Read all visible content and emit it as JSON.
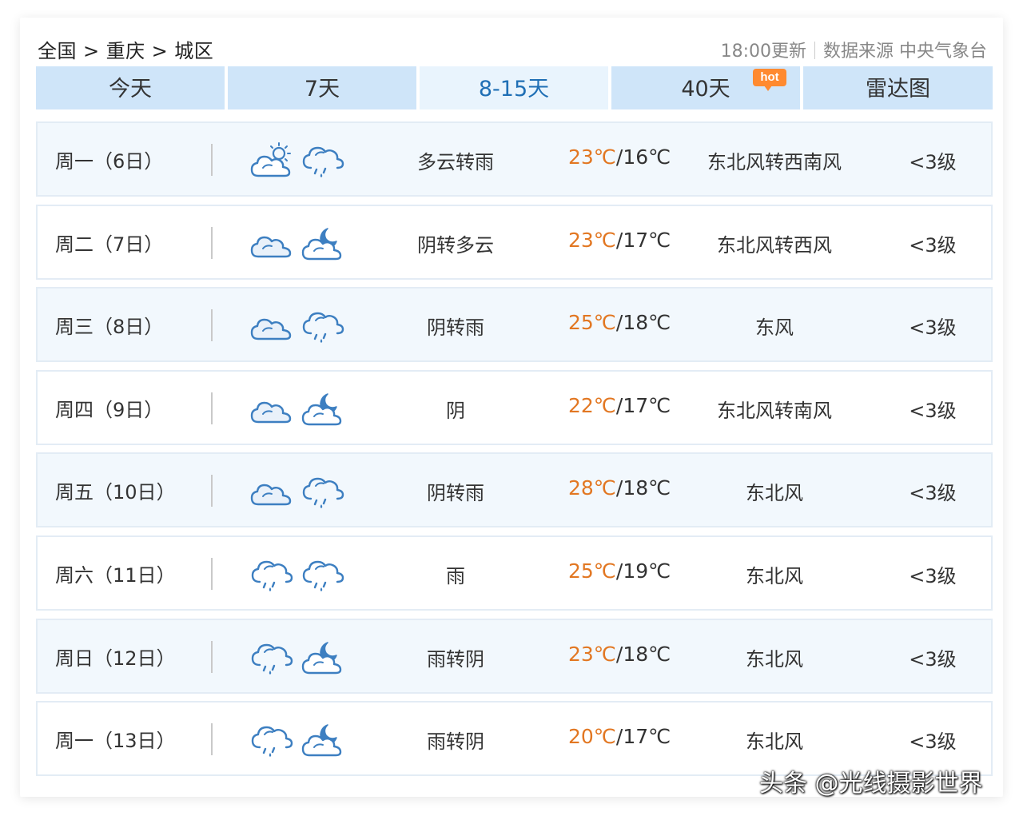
{
  "breadcrumb": [
    "全国",
    "重庆",
    "城区"
  ],
  "breadcrumb_sep": ">",
  "update_time": "18:00更新",
  "data_source": "数据来源 中央气象台",
  "tabs": [
    {
      "label": "今天",
      "active": false
    },
    {
      "label": "7天",
      "active": false
    },
    {
      "label": "8-15天",
      "active": true
    },
    {
      "label": "40天",
      "active": false
    },
    {
      "label": "雷达图",
      "active": false
    }
  ],
  "hot_badge": "hot",
  "rows": [
    {
      "day": "周一（6日）",
      "icon1": "partly-cloudy-sun-icon",
      "icon2": "rain-icon",
      "desc": "多云转雨",
      "high": "23℃",
      "low": "16℃",
      "wind": "东北风转西南风",
      "level": "<3级"
    },
    {
      "day": "周二（7日）",
      "icon1": "overcast-icon",
      "icon2": "partly-cloudy-night-icon",
      "desc": "阴转多云",
      "high": "23℃",
      "low": "17℃",
      "wind": "东北风转西风",
      "level": "<3级"
    },
    {
      "day": "周三（8日）",
      "icon1": "overcast-icon",
      "icon2": "rain-icon",
      "desc": "阴转雨",
      "high": "25℃",
      "low": "18℃",
      "wind": "东风",
      "level": "<3级"
    },
    {
      "day": "周四（9日）",
      "icon1": "overcast-icon",
      "icon2": "partly-cloudy-night-icon",
      "desc": "阴",
      "high": "22℃",
      "low": "17℃",
      "wind": "东北风转南风",
      "level": "<3级"
    },
    {
      "day": "周五（10日）",
      "icon1": "overcast-icon",
      "icon2": "rain-icon",
      "desc": "阴转雨",
      "high": "28℃",
      "low": "18℃",
      "wind": "东北风",
      "level": "<3级"
    },
    {
      "day": "周六（11日）",
      "icon1": "rain-icon",
      "icon2": "rain-icon",
      "desc": "雨",
      "high": "25℃",
      "low": "19℃",
      "wind": "东北风",
      "level": "<3级"
    },
    {
      "day": "周日（12日）",
      "icon1": "rain-icon",
      "icon2": "partly-cloudy-night-icon",
      "desc": "雨转阴",
      "high": "23℃",
      "low": "18℃",
      "wind": "东北风",
      "level": "<3级"
    },
    {
      "day": "周一（13日）",
      "icon1": "rain-icon",
      "icon2": "partly-cloudy-night-icon",
      "desc": "雨转阴",
      "high": "20℃",
      "low": "17℃",
      "wind": "东北风",
      "level": "<3级"
    }
  ],
  "watermark": "头条 @光线摄影世界",
  "colors": {
    "accent": "#1f6fb5",
    "high_temp": "#e27722",
    "tab_bg": "#cfe5f9",
    "icon": "#3d7fc1"
  }
}
